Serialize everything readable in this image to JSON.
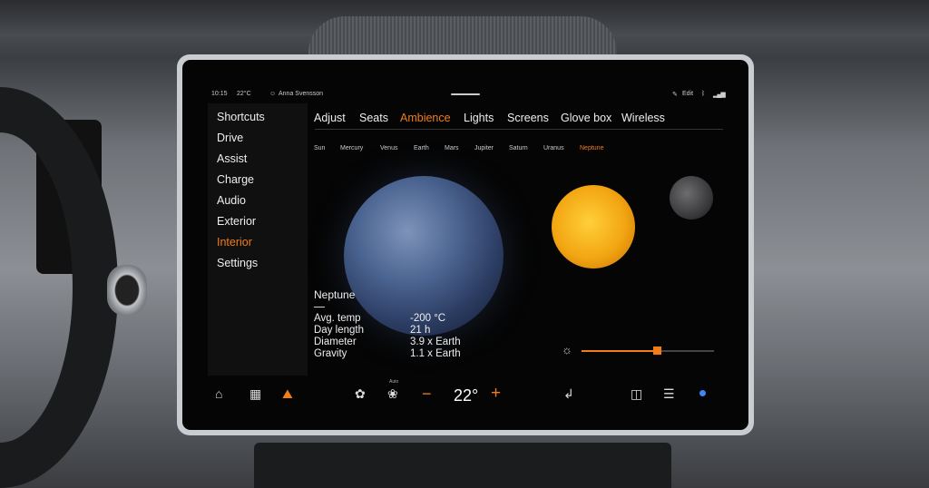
{
  "status_bar": {
    "time": "10:15",
    "temperature": "22°C",
    "user": "Anna Svensson",
    "edit_label": "Edit"
  },
  "sidebar": {
    "items": [
      {
        "label": "Shortcuts"
      },
      {
        "label": "Drive"
      },
      {
        "label": "Assist"
      },
      {
        "label": "Charge"
      },
      {
        "label": "Audio"
      },
      {
        "label": "Exterior"
      },
      {
        "label": "Interior",
        "active": true
      },
      {
        "label": "Settings"
      }
    ]
  },
  "tabs": [
    {
      "label": "Adjust"
    },
    {
      "label": "Seats"
    },
    {
      "label": "Ambience",
      "active": true
    },
    {
      "label": "Lights"
    },
    {
      "label": "Screens"
    },
    {
      "label": "Glove box"
    },
    {
      "label": "Wireless"
    }
  ],
  "subtabs": [
    {
      "label": "Sun"
    },
    {
      "label": "Mercury"
    },
    {
      "label": "Venus"
    },
    {
      "label": "Earth"
    },
    {
      "label": "Mars"
    },
    {
      "label": "Jupiter"
    },
    {
      "label": "Saturn"
    },
    {
      "label": "Uranus"
    },
    {
      "label": "Neptune",
      "active": true
    }
  ],
  "planet_info": {
    "title": "Neptune",
    "rows": [
      {
        "label": "Avg. temp",
        "value": "-200 °C"
      },
      {
        "label": "Day length",
        "value": "21 h"
      },
      {
        "label": "Diameter",
        "value": "3.9 x Earth"
      },
      {
        "label": "Gravity",
        "value": "1.1 x Earth"
      }
    ]
  },
  "brightness": {
    "level_percent": 57
  },
  "climate": {
    "auto_label": "Auto",
    "temperature": "22°",
    "minus": "−",
    "plus": "+"
  },
  "accent_color": "#f07d1a"
}
